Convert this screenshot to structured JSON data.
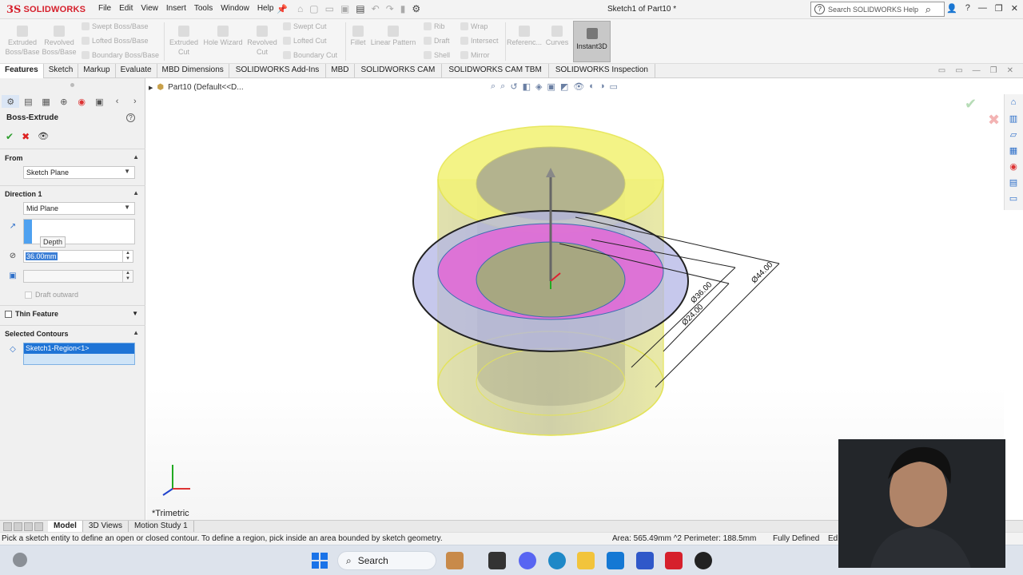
{
  "app": {
    "brand_prefix": "3S",
    "brand_name": "SOLIDWORKS",
    "document_title": "Sketch1 of Part10 *",
    "search_placeholder": "Search SOLIDWORKS Help",
    "menus": [
      "File",
      "Edit",
      "View",
      "Insert",
      "Tools",
      "Window",
      "Help"
    ]
  },
  "command_manager": {
    "extruded_boss": "Extruded Boss/Base",
    "revolved_boss": "Revolved Boss/Base",
    "swept_boss": "Swept Boss/Base",
    "lofted_boss": "Lofted Boss/Base",
    "boundary_boss": "Boundary Boss/Base",
    "extruded_cut": "Extruded Cut",
    "hole_wizard": "Hole Wizard",
    "revolved_cut": "Revolved Cut",
    "swept_cut": "Swept Cut",
    "lofted_cut": "Lofted Cut",
    "boundary_cut": "Boundary Cut",
    "fillet": "Fillet",
    "linear_pattern": "Linear Pattern",
    "rib": "Rib",
    "draft": "Draft",
    "shell": "Shell",
    "wrap": "Wrap",
    "intersect": "Intersect",
    "mirror": "Mirror",
    "reference": "Referenc...",
    "curves": "Curves",
    "instant3d": "Instant3D"
  },
  "tabs": [
    "Features",
    "Sketch",
    "Markup",
    "Evaluate",
    "MBD Dimensions",
    "SOLIDWORKS Add-Ins",
    "MBD",
    "SOLIDWORKS CAM",
    "SOLIDWORKS CAM TBM",
    "SOLIDWORKS Inspection"
  ],
  "property_manager": {
    "title": "Boss-Extrude",
    "from_label": "From",
    "from_value": "Sketch Plane",
    "direction_label": "Direction 1",
    "direction_value": "Mid Plane",
    "depth_tooltip": "Depth",
    "depth_value": "36.00mm",
    "draft_outward": "Draft outward",
    "thin_feature": "Thin Feature",
    "selected_contours_label": "Selected Contours",
    "selected_contour": "Sketch1-Region<1>"
  },
  "viewport": {
    "breadcrumb": "Part10  (Default<<D...",
    "view_name": "*Trimetric",
    "dim_44": "Ø44.00",
    "dim_36": "Ø36.00",
    "dim_24": "Ø24.00"
  },
  "bottom_tabs": [
    "Model",
    "3D Views",
    "Motion Study 1"
  ],
  "status": {
    "message": "Pick a sketch entity to define an open or closed contour. To define a region, pick inside an area bounded by sketch geometry.",
    "measure": "Area: 565.49mm ^2 Perimeter: 188.5mm",
    "state": "Fully Defined",
    "edit": "Ed"
  },
  "taskbar": {
    "search_label": "Search"
  },
  "colors": {
    "brand_red": "#d6202c",
    "selection_blue": "#1f74d6",
    "part_yellow": "#e9e98a",
    "region_magenta": "#e060d6"
  }
}
